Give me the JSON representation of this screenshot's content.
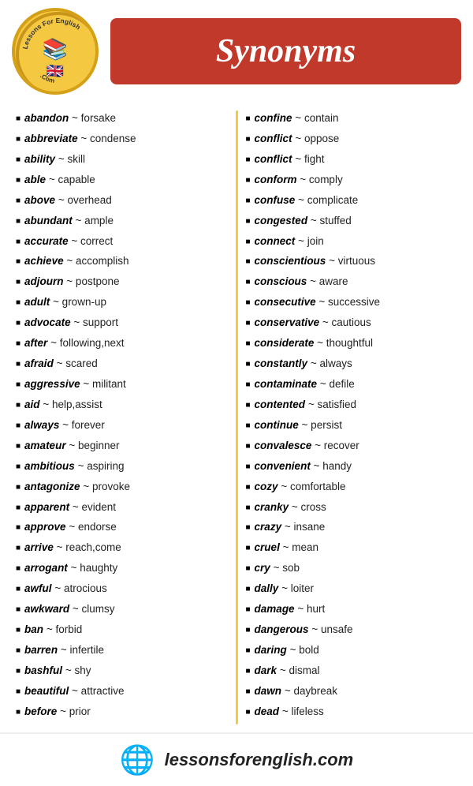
{
  "header": {
    "title": "Synonyms",
    "logo_top": "LessonsForEnglish",
    "logo_bottom": ".Com",
    "footer_url": "lessonsforenglish.com"
  },
  "left_column": [
    {
      "word": "abandon",
      "synonym": "forsake"
    },
    {
      "word": "abbreviate",
      "synonym": "condense"
    },
    {
      "word": "ability",
      "synonym": "skill"
    },
    {
      "word": "able",
      "synonym": "capable"
    },
    {
      "word": "above",
      "synonym": "overhead"
    },
    {
      "word": "abundant",
      "synonym": "ample"
    },
    {
      "word": "accurate",
      "synonym": "correct"
    },
    {
      "word": "achieve",
      "synonym": "accomplish"
    },
    {
      "word": "adjourn",
      "synonym": "postpone"
    },
    {
      "word": "adult",
      "synonym": "grown-up"
    },
    {
      "word": "advocate",
      "synonym": "support"
    },
    {
      "word": "after",
      "synonym": "following,next"
    },
    {
      "word": "afraid",
      "synonym": "scared"
    },
    {
      "word": "aggressive",
      "synonym": "militant"
    },
    {
      "word": "aid",
      "synonym": "help,assist"
    },
    {
      "word": "always",
      "synonym": "forever"
    },
    {
      "word": "amateur",
      "synonym": "beginner"
    },
    {
      "word": "ambitious",
      "synonym": "aspiring"
    },
    {
      "word": "antagonize",
      "synonym": "provoke"
    },
    {
      "word": "apparent",
      "synonym": "evident"
    },
    {
      "word": "approve",
      "synonym": "endorse"
    },
    {
      "word": "arrive",
      "synonym": "reach,come"
    },
    {
      "word": "arrogant",
      "synonym": "haughty"
    },
    {
      "word": "awful",
      "synonym": "atrocious"
    },
    {
      "word": "awkward",
      "synonym": "clumsy"
    },
    {
      "word": "ban",
      "synonym": "forbid"
    },
    {
      "word": "barren",
      "synonym": "infertile"
    },
    {
      "word": "bashful",
      "synonym": "shy"
    },
    {
      "word": "beautiful",
      "synonym": "attractive"
    },
    {
      "word": "before",
      "synonym": "prior"
    }
  ],
  "right_column": [
    {
      "word": "confine",
      "synonym": "contain"
    },
    {
      "word": "conflict",
      "synonym": "oppose"
    },
    {
      "word": "conflict",
      "synonym": "fight"
    },
    {
      "word": "conform",
      "synonym": "comply"
    },
    {
      "word": "confuse",
      "synonym": "complicate"
    },
    {
      "word": "congested",
      "synonym": "stuffed"
    },
    {
      "word": "connect",
      "synonym": "join"
    },
    {
      "word": "conscientious",
      "synonym": "virtuous"
    },
    {
      "word": "conscious",
      "synonym": "aware"
    },
    {
      "word": "consecutive",
      "synonym": "successive"
    },
    {
      "word": "conservative",
      "synonym": "cautious"
    },
    {
      "word": "considerate",
      "synonym": "thoughtful"
    },
    {
      "word": "constantly",
      "synonym": "always"
    },
    {
      "word": "contaminate",
      "synonym": "defile"
    },
    {
      "word": "contented",
      "synonym": "satisfied"
    },
    {
      "word": "continue",
      "synonym": "persist"
    },
    {
      "word": "convalesce",
      "synonym": "recover"
    },
    {
      "word": "convenient",
      "synonym": "handy"
    },
    {
      "word": "cozy",
      "synonym": "comfortable"
    },
    {
      "word": "cranky",
      "synonym": "cross"
    },
    {
      "word": "crazy",
      "synonym": "insane"
    },
    {
      "word": "cruel",
      "synonym": "mean"
    },
    {
      "word": "cry",
      "synonym": "sob"
    },
    {
      "word": "dally",
      "synonym": "loiter"
    },
    {
      "word": "damage",
      "synonym": "hurt"
    },
    {
      "word": "dangerous",
      "synonym": "unsafe"
    },
    {
      "word": "daring",
      "synonym": "bold"
    },
    {
      "word": "dark",
      "synonym": "dismal"
    },
    {
      "word": "dawn",
      "synonym": "daybreak"
    },
    {
      "word": "dead",
      "synonym": "lifeless"
    }
  ]
}
